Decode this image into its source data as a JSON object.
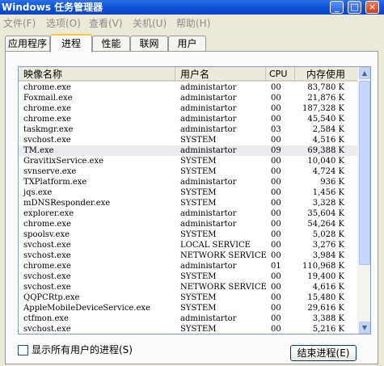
{
  "window": {
    "title": "Windows 任务管理器",
    "min_icon": "minimize-icon",
    "max_icon": "maximize-icon",
    "close_icon": "close-icon",
    "min_glyph": "_",
    "max_glyph": "□",
    "close_glyph": "×"
  },
  "menu": [
    "文件(F)",
    "选项(O)",
    "查看(V)",
    "关机(U)",
    "帮助(H)"
  ],
  "tabs": [
    {
      "label": "应用程序",
      "active": false
    },
    {
      "label": "进程",
      "active": true
    },
    {
      "label": "性能",
      "active": false
    },
    {
      "label": "联网",
      "active": false
    },
    {
      "label": "用户",
      "active": false
    }
  ],
  "table": {
    "headers": [
      "映像名称",
      "用户名",
      "CPU",
      "内存使用"
    ],
    "selected_row": 6,
    "rows": [
      [
        "chrome.exe",
        "administartor",
        "00",
        "83,780 K"
      ],
      [
        "Foxmail.exe",
        "administartor",
        "00",
        "21,876 K"
      ],
      [
        "chrome.exe",
        "administartor",
        "00",
        "187,328 K"
      ],
      [
        "chrome.exe",
        "administartor",
        "00",
        "45,540 K"
      ],
      [
        "taskmgr.exe",
        "administartor",
        "03",
        "2,584 K"
      ],
      [
        "svchost.exe",
        "SYSTEM",
        "00",
        "4,516 K"
      ],
      [
        "TM.exe",
        "administartor",
        "09",
        "69,388 K"
      ],
      [
        "GravitixService.exe",
        "SYSTEM",
        "00",
        "10,040 K"
      ],
      [
        "svnserve.exe",
        "SYSTEM",
        "00",
        "4,724 K"
      ],
      [
        "TXPlatform.exe",
        "administartor",
        "00",
        "936 K"
      ],
      [
        "jqs.exe",
        "SYSTEM",
        "00",
        "1,456 K"
      ],
      [
        "mDNSResponder.exe",
        "SYSTEM",
        "00",
        "3,328 K"
      ],
      [
        "explorer.exe",
        "administartor",
        "00",
        "35,604 K"
      ],
      [
        "chrome.exe",
        "administartor",
        "00",
        "54,264 K"
      ],
      [
        "spoolsv.exe",
        "SYSTEM",
        "00",
        "5,028 K"
      ],
      [
        "svchost.exe",
        "LOCAL SERVICE",
        "00",
        "3,276 K"
      ],
      [
        "svchost.exe",
        "NETWORK SERVICE",
        "00",
        "3,984 K"
      ],
      [
        "chrome.exe",
        "administartor",
        "01",
        "110,968 K"
      ],
      [
        "svchost.exe",
        "SYSTEM",
        "00",
        "19,400 K"
      ],
      [
        "svchost.exe",
        "NETWORK SERVICE",
        "00",
        "4,616 K"
      ],
      [
        "QQPCRtp.exe",
        "SYSTEM",
        "00",
        "15,480 K"
      ],
      [
        "AppleMobileDeviceService.exe",
        "SYSTEM",
        "00",
        "29,616 K"
      ],
      [
        "ctfmon.exe",
        "administartor",
        "00",
        "3,388 K"
      ],
      [
        "svchost.exe",
        "SYSTEM",
        "00",
        "5,216 K"
      ]
    ]
  },
  "show_all_users": {
    "label": "显示所有用户的进程(S)",
    "checked": false
  },
  "end_process": {
    "label": "结束进程(E)"
  },
  "scroll": {
    "up_icon": "scroll-up-arrow-icon",
    "down_icon": "scroll-down-arrow-icon",
    "up_glyph": "▲",
    "down_glyph": "▼"
  }
}
